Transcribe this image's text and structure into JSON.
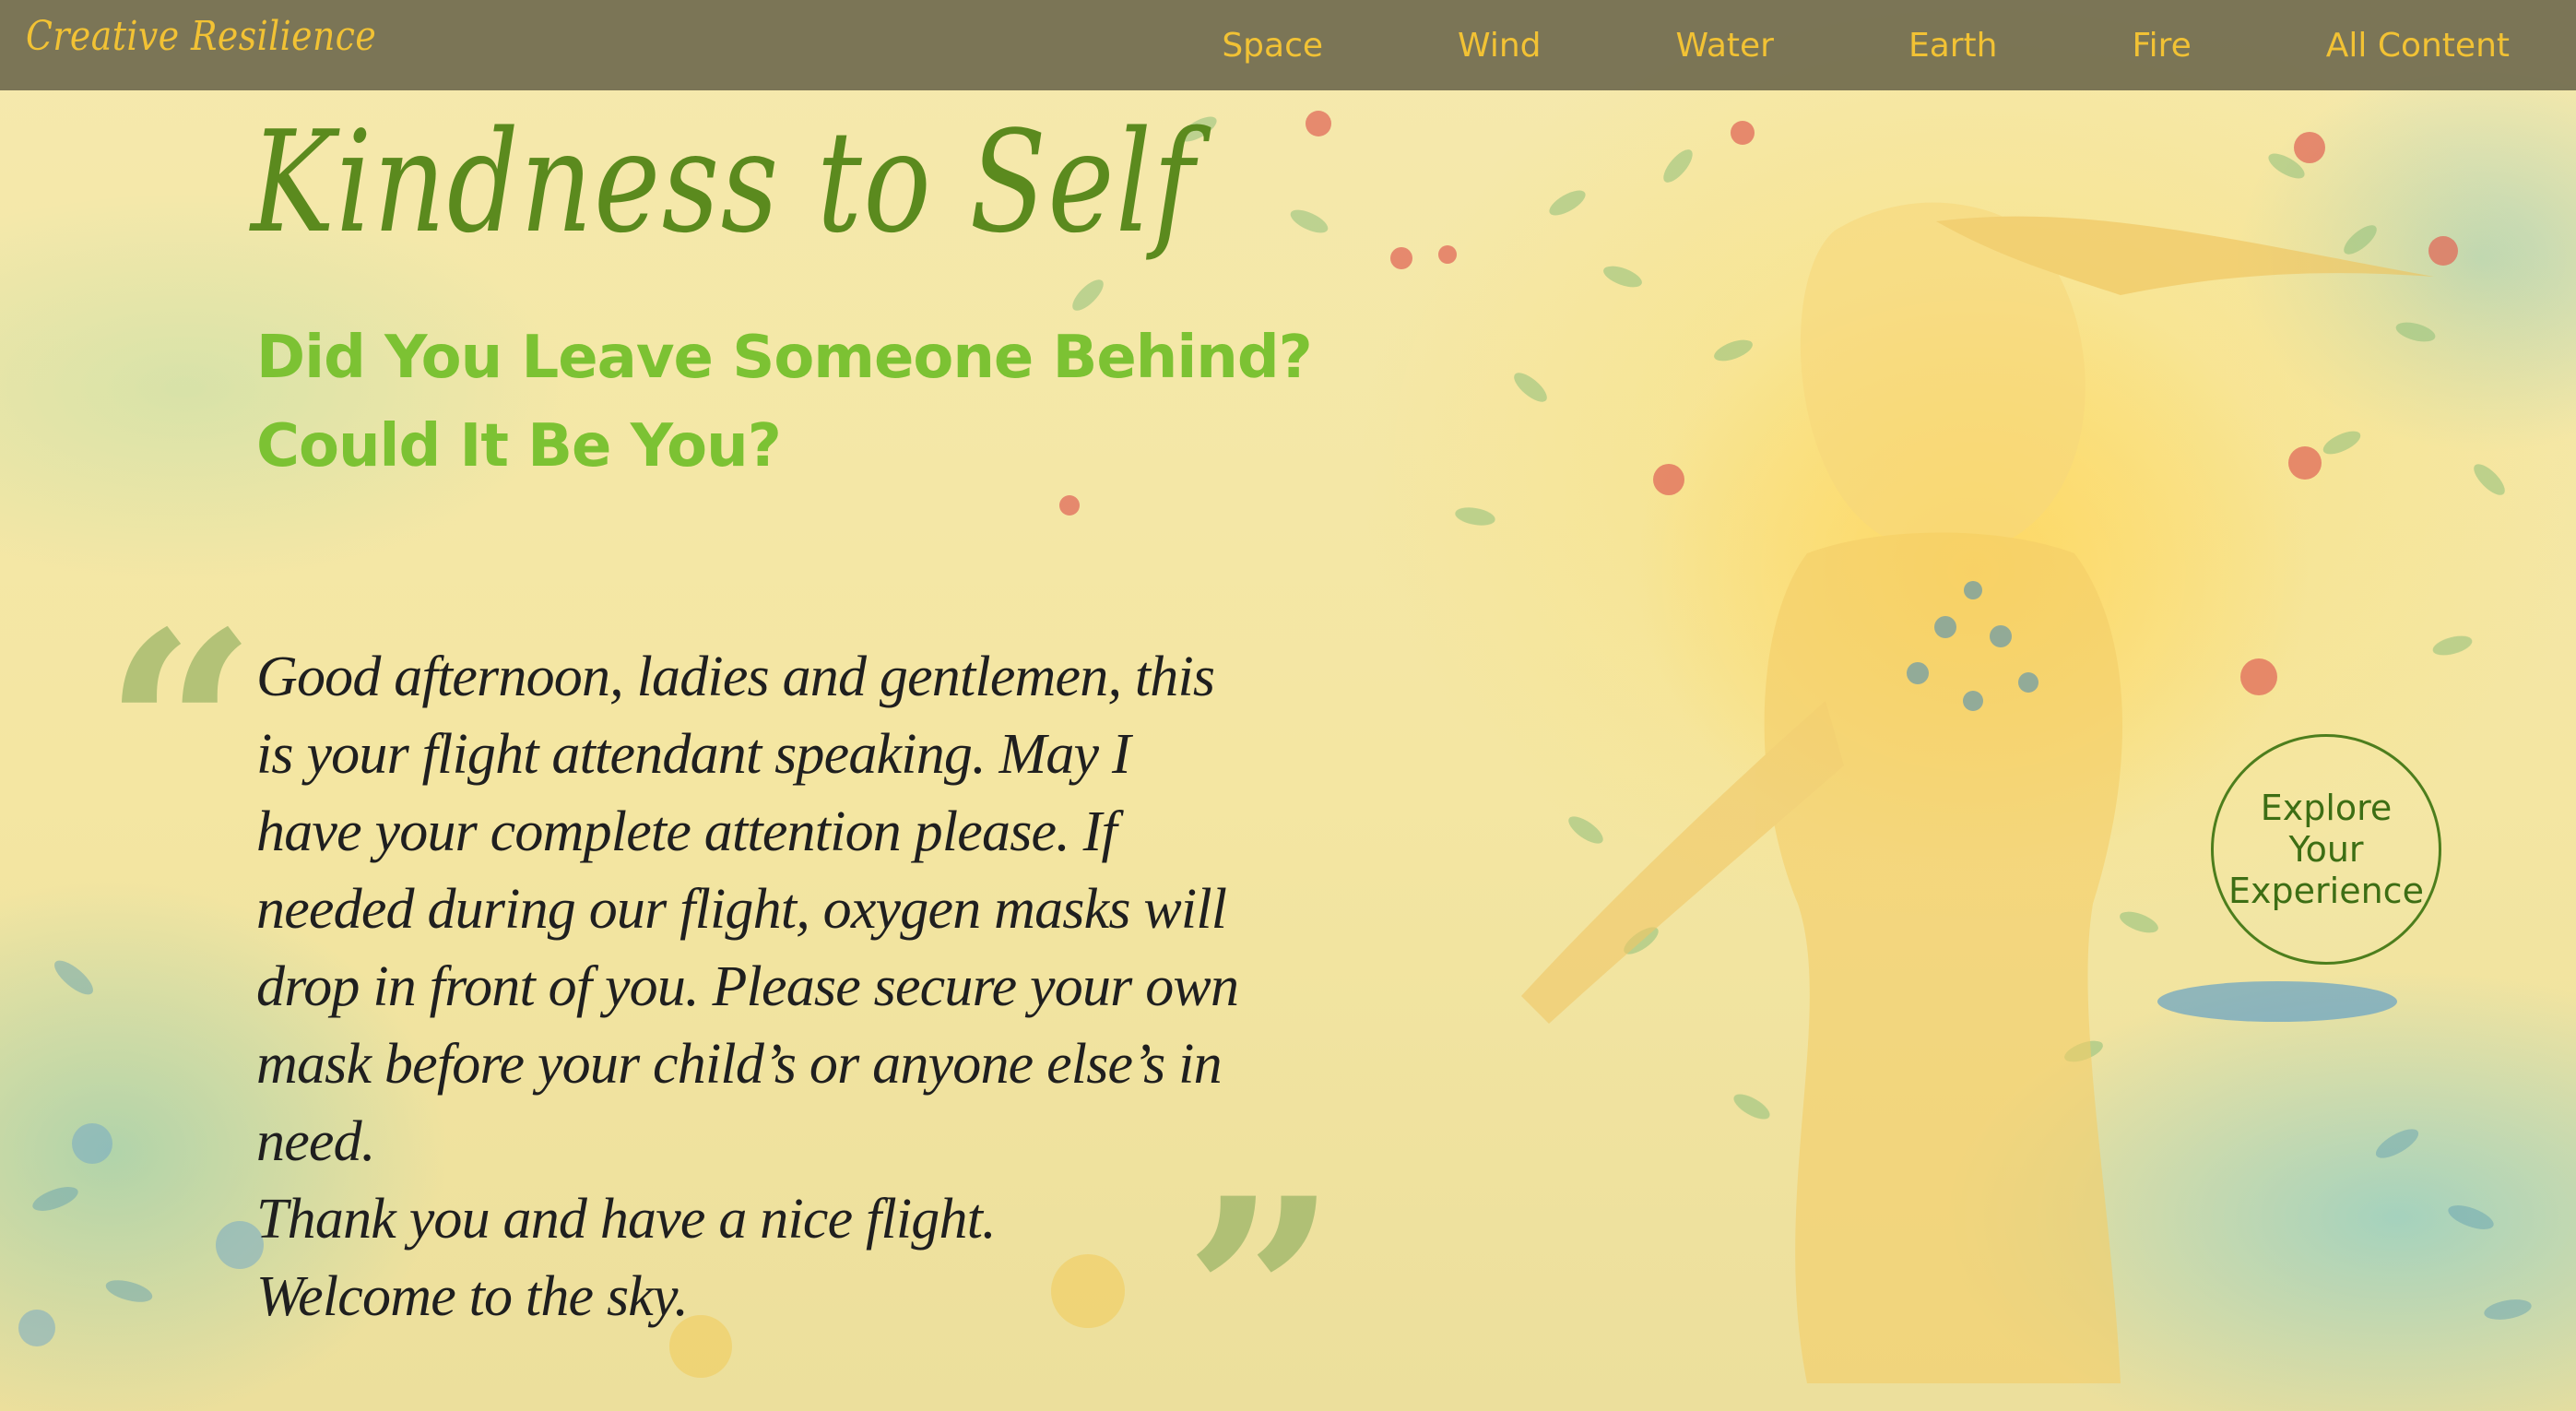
{
  "header": {
    "brand": "Creative Resilience",
    "nav": [
      "Space",
      "Wind",
      "Water",
      "Earth",
      "Fire",
      "All Content"
    ]
  },
  "main": {
    "title": "Kindness to Self",
    "subtitle_lines": [
      "Did You Leave Someone Behind?",
      "Could It Be You?"
    ],
    "quote_lines": [
      "Good afternoon, ladies and gentlemen, this",
      "is your flight attendant speaking. May I",
      "have your complete attention please. If",
      "needed during our flight, oxygen masks will",
      "drop in front of you. Please secure your own",
      "mask before your child’s or anyone else’s in",
      "need.",
      "Thank you and have a nice flight.",
      "Welcome to the sky."
    ]
  },
  "explore_button": {
    "lines": [
      "Explore",
      "Your",
      "Experience"
    ]
  },
  "colors": {
    "header_bg": "#58543e",
    "nav_text": "#f2c234",
    "title": "#5b8a1e",
    "subtitle": "#7cc233",
    "quote_text": "#1f1f1f",
    "badge": "#3d6e14"
  }
}
